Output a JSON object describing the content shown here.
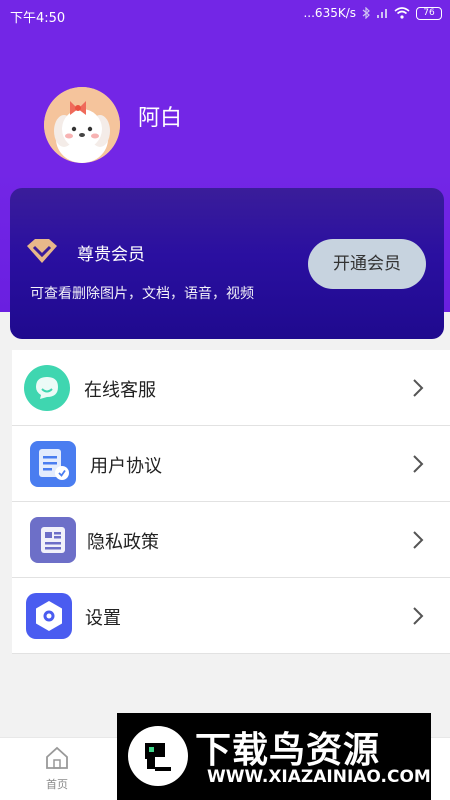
{
  "status_bar": {
    "time": "下午4:50",
    "network_speed": "...635K/s",
    "battery": "76"
  },
  "profile": {
    "username": "阿白",
    "avatar_icon": "cartoon-dog-avatar-icon"
  },
  "vip": {
    "title": "尊贵会员",
    "description": "可查看删除图片，文档，语音，视频",
    "button_label": "开通会员",
    "icon": "diamond-icon"
  },
  "menu": {
    "items": [
      {
        "label": "在线客服",
        "icon": "chat-bubble-icon",
        "color": "#3fd6b0"
      },
      {
        "label": "用户协议",
        "icon": "agreement-doc-icon",
        "color": "#4a7df0"
      },
      {
        "label": "隐私政策",
        "icon": "document-icon",
        "color": "#6d6fc8"
      },
      {
        "label": "设置",
        "icon": "settings-hex-icon",
        "color": "#4a5cf0"
      }
    ]
  },
  "bottom_nav": {
    "home_label": "首页"
  },
  "watermark": {
    "title": "下载鸟资源",
    "url": "WWW.XIAZAINIAO.COM"
  },
  "colors": {
    "header_purple": "#7326e6",
    "vip_card_blue": "#2a0fa0",
    "vip_button": "#c7d3df"
  }
}
